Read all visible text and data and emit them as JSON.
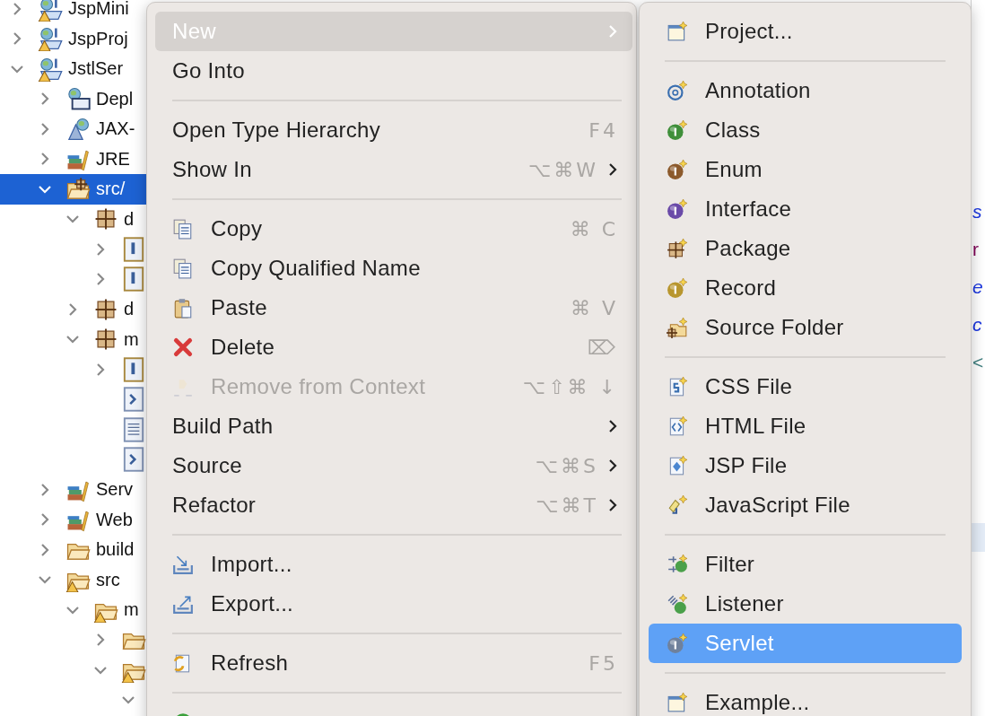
{
  "tree": [
    {
      "label": "JspMini",
      "kind": "project",
      "expanded": false,
      "selected": false
    },
    {
      "label": "JspProj",
      "kind": "project",
      "expanded": false,
      "selected": false
    },
    {
      "label": "JstlSer",
      "kind": "project",
      "expanded": true,
      "selected": false,
      "children": [
        {
          "label": "Depl",
          "kind": "deploy",
          "expanded": false,
          "selected": false
        },
        {
          "label": "JAX-",
          "kind": "webservice",
          "expanded": false,
          "selected": false
        },
        {
          "label": "JRE",
          "kind": "library",
          "expanded": false,
          "selected": false
        },
        {
          "label": "src/",
          "kind": "source-folder",
          "expanded": true,
          "selected": true,
          "children": [
            {
              "label": "d",
              "kind": "package",
              "expanded": true,
              "selected": false,
              "children": [
                {
                  "kind": "java",
                  "expanded": false,
                  "selected": false
                },
                {
                  "kind": "java",
                  "expanded": false,
                  "selected": false
                }
              ]
            },
            {
              "label": "d",
              "kind": "package",
              "expanded": false,
              "selected": false
            },
            {
              "label": "m",
              "kind": "package",
              "expanded": true,
              "selected": false,
              "children": [
                {
                  "kind": "java",
                  "expanded": false,
                  "selected": false
                },
                {
                  "kind": "xml",
                  "selected": false
                },
                {
                  "kind": "text",
                  "selected": false
                },
                {
                  "kind": "xml",
                  "selected": false
                }
              ]
            }
          ]
        },
        {
          "label": "Serv",
          "kind": "library",
          "expanded": false,
          "selected": false
        },
        {
          "label": "Web",
          "kind": "library",
          "expanded": false,
          "selected": false
        },
        {
          "label": "build",
          "kind": "folder",
          "expanded": false,
          "selected": false
        },
        {
          "label": "src",
          "kind": "folder-warning",
          "expanded": true,
          "selected": false,
          "children": [
            {
              "label": "m",
              "kind": "folder-warning",
              "expanded": true,
              "selected": false,
              "children": [
                {
                  "kind": "folder",
                  "expanded": false,
                  "selected": false
                },
                {
                  "kind": "folder-warning",
                  "expanded": true,
                  "selected": false,
                  "children": [
                    {
                      "expanded": true,
                      "selected": false
                    }
                  ]
                }
              ]
            }
          ]
        }
      ]
    }
  ],
  "editor_fragments": [
    {
      "text": "s",
      "kind": "field"
    },
    {
      "text": "r",
      "kind": "keyword"
    },
    {
      "text": "e",
      "kind": "field"
    },
    {
      "text": "c",
      "kind": "field"
    },
    {
      "text": "<",
      "kind": "tag"
    }
  ],
  "context_menu": {
    "active": false,
    "items": [
      {
        "kind": "item",
        "label": "New",
        "submenu": true,
        "selected": true,
        "disabled": false
      },
      {
        "kind": "item",
        "label": "Go Into",
        "submenu": false,
        "selected": false,
        "disabled": false
      },
      {
        "kind": "separator"
      },
      {
        "kind": "item",
        "label": "Open Type Hierarchy",
        "shortcut": "F4",
        "submenu": false,
        "selected": false,
        "disabled": false
      },
      {
        "kind": "item",
        "label": "Show In",
        "shortcut": "⌥⌘W",
        "submenu": true,
        "selected": false,
        "disabled": false
      },
      {
        "kind": "separator"
      },
      {
        "kind": "item",
        "label": "Copy",
        "shortcut": "⌘ C",
        "submenu": false,
        "selected": false,
        "disabled": false
      },
      {
        "kind": "item",
        "label": "Copy Qualified Name",
        "submenu": false,
        "selected": false,
        "disabled": false
      },
      {
        "kind": "item",
        "label": "Paste",
        "shortcut": "⌘ V",
        "submenu": false,
        "selected": false,
        "disabled": false
      },
      {
        "kind": "item",
        "label": "Delete",
        "shortcut": "⌦",
        "submenu": false,
        "selected": false,
        "disabled": false
      },
      {
        "kind": "item",
        "label": "Remove from Context",
        "shortcut": "⌥⇧⌘ ↓",
        "submenu": false,
        "selected": false,
        "disabled": true
      },
      {
        "kind": "item",
        "label": "Build Path",
        "submenu": true,
        "selected": false,
        "disabled": false
      },
      {
        "kind": "item",
        "label": "Source",
        "shortcut": "⌥⌘S",
        "submenu": true,
        "selected": false,
        "disabled": false
      },
      {
        "kind": "item",
        "label": "Refactor",
        "shortcut": "⌥⌘T",
        "submenu": true,
        "selected": false,
        "disabled": false
      },
      {
        "kind": "separator"
      },
      {
        "kind": "item",
        "label": "Import...",
        "submenu": false,
        "selected": false,
        "disabled": false
      },
      {
        "kind": "item",
        "label": "Export...",
        "submenu": false,
        "selected": false,
        "disabled": false
      },
      {
        "kind": "separator"
      },
      {
        "kind": "item",
        "label": "Refresh",
        "shortcut": "F5",
        "submenu": false,
        "selected": false,
        "disabled": false
      },
      {
        "kind": "separator"
      },
      {
        "kind": "item",
        "selected": false,
        "disabled": false
      }
    ]
  },
  "submenu": {
    "active": true,
    "items": [
      {
        "kind": "item",
        "label": "Project...",
        "selected": false
      },
      {
        "kind": "separator"
      },
      {
        "kind": "item",
        "label": "Annotation",
        "selected": false
      },
      {
        "kind": "item",
        "label": "Class",
        "selected": false
      },
      {
        "kind": "item",
        "label": "Enum",
        "selected": false
      },
      {
        "kind": "item",
        "label": "Interface",
        "selected": false
      },
      {
        "kind": "item",
        "label": "Package",
        "selected": false
      },
      {
        "kind": "item",
        "label": "Record",
        "selected": false
      },
      {
        "kind": "item",
        "label": "Source Folder",
        "selected": false
      },
      {
        "kind": "separator"
      },
      {
        "kind": "item",
        "label": "CSS File",
        "selected": false
      },
      {
        "kind": "item",
        "label": "HTML File",
        "selected": false
      },
      {
        "kind": "item",
        "label": "JSP File",
        "selected": false
      },
      {
        "kind": "item",
        "label": "JavaScript File",
        "selected": false
      },
      {
        "kind": "separator"
      },
      {
        "kind": "item",
        "label": "Filter",
        "selected": false
      },
      {
        "kind": "item",
        "label": "Listener",
        "selected": false
      },
      {
        "kind": "item",
        "label": "Servlet",
        "selected": true
      },
      {
        "kind": "separator"
      },
      {
        "kind": "item",
        "label": "Example...",
        "selected": false
      }
    ]
  }
}
